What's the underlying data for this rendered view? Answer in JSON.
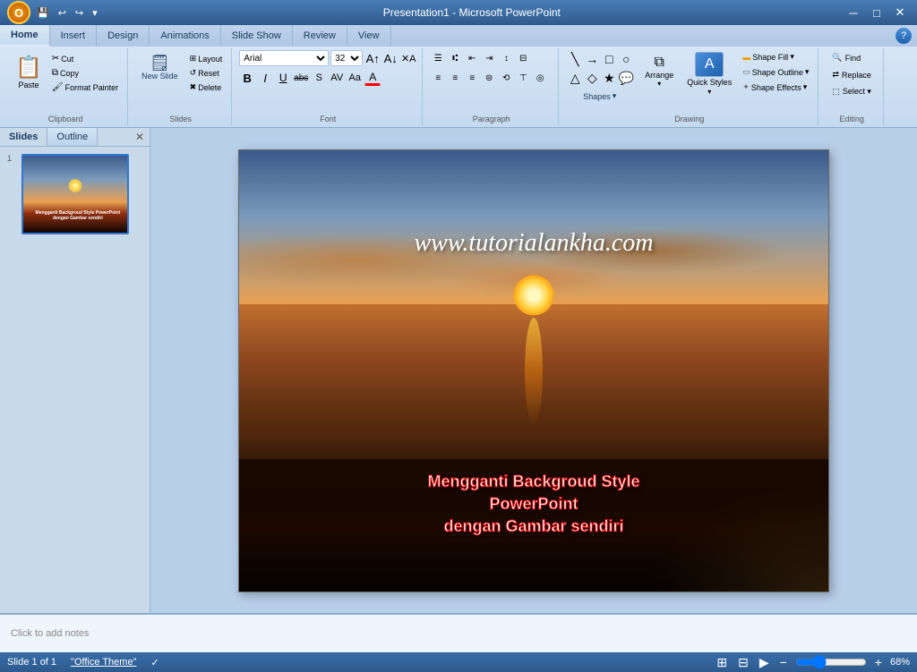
{
  "titleBar": {
    "title": "Presentation1 - Microsoft PowerPoint",
    "minBtn": "─",
    "maxBtn": "□",
    "closeBtn": "✕"
  },
  "ribbon": {
    "tabs": [
      "Home",
      "Insert",
      "Design",
      "Animations",
      "Slide Show",
      "Review",
      "View"
    ],
    "activeTab": "Home",
    "groups": {
      "clipboard": {
        "label": "Clipboard",
        "paste": "Paste",
        "cut": "Cut",
        "copy": "Copy",
        "formatPainter": "Format Painter"
      },
      "slides": {
        "label": "Slides",
        "newSlide": "New Slide",
        "layout": "Layout",
        "reset": "Reset",
        "delete": "Delete"
      },
      "font": {
        "label": "Font",
        "fontName": "Arial",
        "fontSize": "32",
        "bold": "B",
        "italic": "I",
        "underline": "U",
        "strikethrough": "abc",
        "shadow": "S",
        "charSpacing": "AV",
        "changeCase": "Aa",
        "fontColor": "A"
      },
      "paragraph": {
        "label": "Paragraph",
        "bulletList": "≡",
        "numberedList": "≡",
        "decIndent": "⇤",
        "incIndent": "⇥",
        "lineSpacing": "↕",
        "alignLeft": "≡",
        "alignCenter": "≡",
        "alignRight": "≡",
        "justify": "≡",
        "columns": "⊞",
        "textDir": "↕",
        "alignText": "⊤",
        "convertToSmart": "◎"
      },
      "drawing": {
        "label": "Drawing",
        "quickStyles": "Quick Styles",
        "shapeFill": "Shape Fill",
        "shapeOutline": "Shape Outline",
        "shapeEffects": "Shape Effects",
        "arrange": "Arrange",
        "shapes": "Shapes"
      },
      "editing": {
        "label": "Editing",
        "find": "Find",
        "replace": "Replace",
        "select": "Select ▾"
      }
    }
  },
  "slidePanel": {
    "tabs": [
      "Slides",
      "Outline"
    ],
    "closeBtn": "✕",
    "slideNumber": "1"
  },
  "slide": {
    "title": "www.tutorialankha.com",
    "subtitle": "Mengganti Backgroud Style PowerPoint\ndengan Gambar sendiri"
  },
  "notes": {
    "placeholder": "Click to add notes"
  },
  "statusBar": {
    "slideInfo": "Slide 1 of 1",
    "theme": "\"Office Theme\"",
    "spellingIcon": "✓",
    "zoom": "68%"
  }
}
